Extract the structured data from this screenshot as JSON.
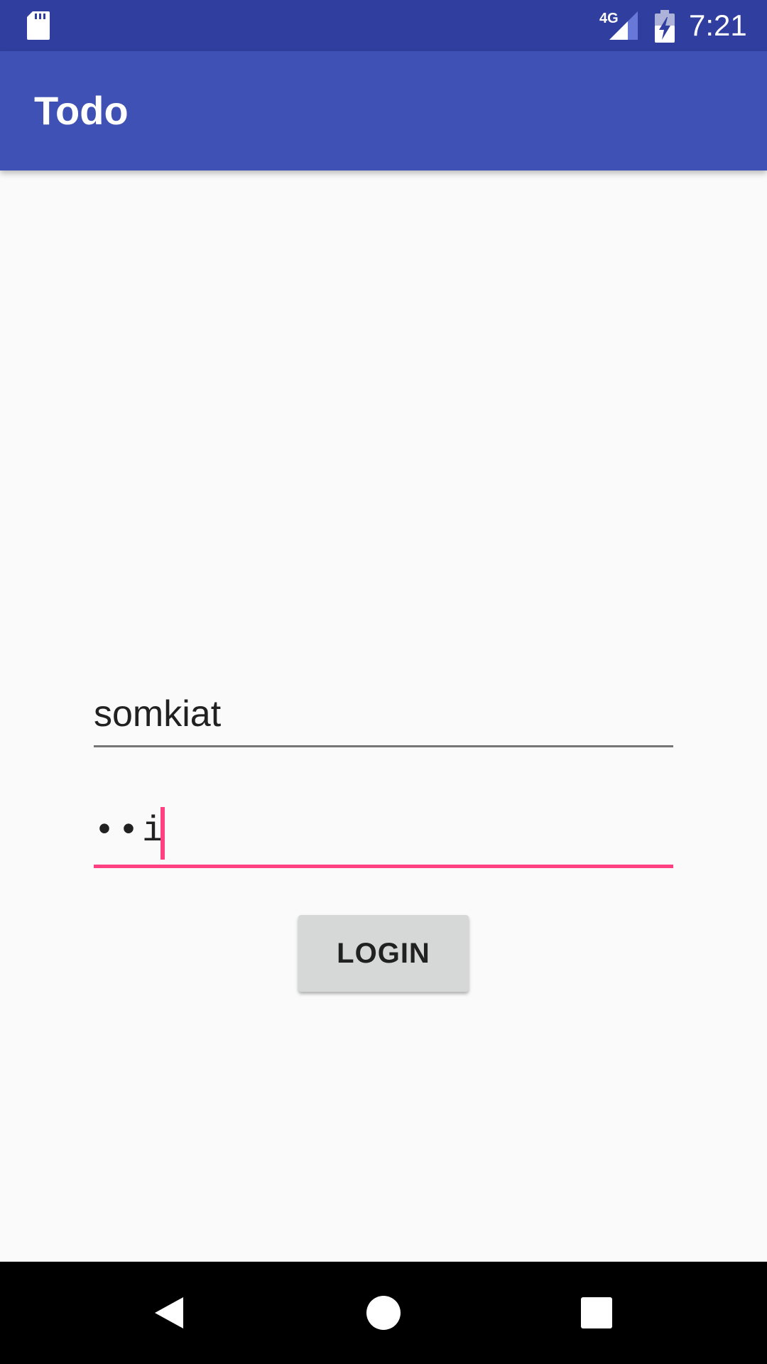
{
  "status_bar": {
    "time": "7:21",
    "network": "4G",
    "icons": [
      "sd-card-icon",
      "signal-icon",
      "battery-charging-icon"
    ]
  },
  "app_bar": {
    "title": "Todo"
  },
  "form": {
    "username_value": "somkiat",
    "password_value": "••i",
    "login_label": "LOGIN"
  },
  "nav_bar": {
    "icons": [
      "back-icon",
      "home-icon",
      "recents-icon"
    ]
  },
  "colors": {
    "status_bar": "#303f9f",
    "app_bar": "#3f51b5",
    "accent": "#ff4081",
    "background": "#fafafa",
    "button": "#d6d7d7"
  }
}
